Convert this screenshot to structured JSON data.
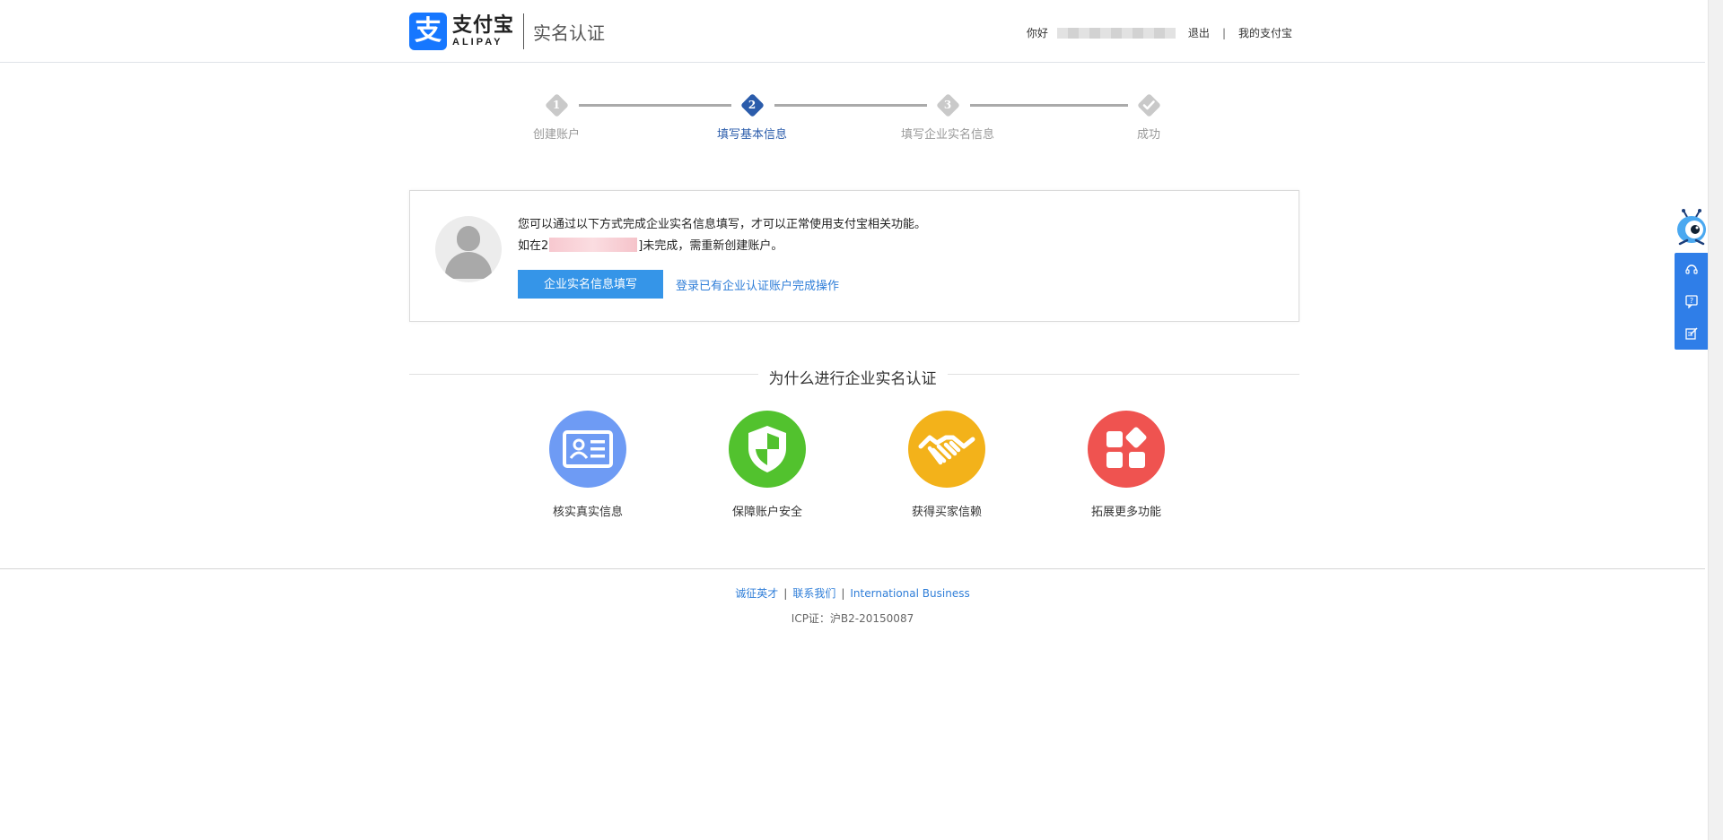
{
  "header": {
    "logo_cn": "支付宝",
    "logo_en": "ALIPAY",
    "subtitle": "实名认证",
    "hello": "你好",
    "logout": "退出",
    "separator": "|",
    "my_alipay": "我的支付宝"
  },
  "steps": [
    {
      "num": "1",
      "label": "创建账户",
      "state": "done"
    },
    {
      "num": "2",
      "label": "填写基本信息",
      "state": "active"
    },
    {
      "num": "3",
      "label": "填写企业实名信息",
      "state": "pending"
    },
    {
      "num": "",
      "icon": "check-icon",
      "label": "成功",
      "state": "pending"
    }
  ],
  "info": {
    "line1": "您可以通过以下方式完成企业实名信息填写，才可以正常使用支付宝相关功能。",
    "line2_prefix": "如在2",
    "line2_suffix": "]未完成，需重新创建账户。",
    "primary_button": "企业实名信息填写",
    "link_button": "登录已有企业认证账户完成操作"
  },
  "why": {
    "title": "为什么进行企业实名认证",
    "features": [
      {
        "label": "核实真实信息",
        "icon": "id-card-icon",
        "color": "#6e9bf4"
      },
      {
        "label": "保障账户安全",
        "icon": "shield-icon",
        "color": "#52c22e"
      },
      {
        "label": "获得买家信赖",
        "icon": "handshake-icon",
        "color": "#f3b21a"
      },
      {
        "label": "拓展更多功能",
        "icon": "apps-grid-icon",
        "color": "#ef5350"
      }
    ]
  },
  "footer": {
    "links": [
      "诚征英才",
      "联系我们",
      "International Business"
    ],
    "separator": "|",
    "icp": "ICP证：沪B2-20150087"
  },
  "colors": {
    "brand_blue": "#1677ff",
    "active_step": "#2b5cab",
    "primary_button": "#3595e8",
    "link": "#2f7ed8",
    "side_bar": "#2f7ee8"
  }
}
